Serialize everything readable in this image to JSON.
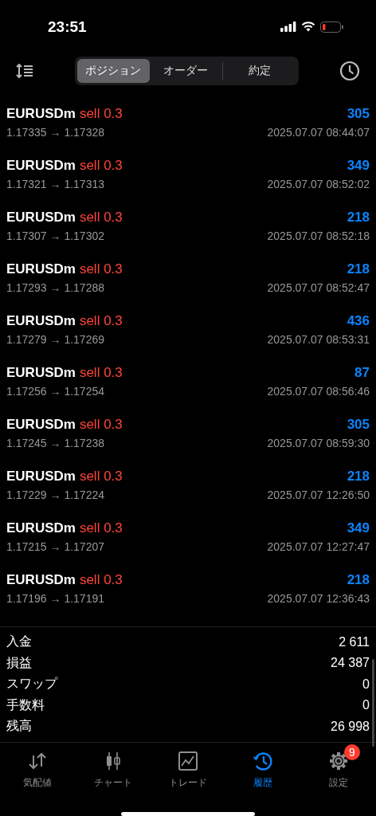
{
  "status_bar": {
    "time": "23:51"
  },
  "segments": [
    {
      "label": "ポジション",
      "selected": true
    },
    {
      "label": "オーダー",
      "selected": false
    },
    {
      "label": "約定",
      "selected": false
    }
  ],
  "deals": [
    {
      "symbol": "EURUSDm",
      "order": "sell 0.3",
      "profit": "305",
      "prices": "1.17335 → 1.17328",
      "time": "2025.07.07 08:44:07"
    },
    {
      "symbol": "EURUSDm",
      "order": "sell 0.3",
      "profit": "349",
      "prices": "1.17321 → 1.17313",
      "time": "2025.07.07 08:52:02"
    },
    {
      "symbol": "EURUSDm",
      "order": "sell 0.3",
      "profit": "218",
      "prices": "1.17307 → 1.17302",
      "time": "2025.07.07 08:52:18"
    },
    {
      "symbol": "EURUSDm",
      "order": "sell 0.3",
      "profit": "218",
      "prices": "1.17293 → 1.17288",
      "time": "2025.07.07 08:52:47"
    },
    {
      "symbol": "EURUSDm",
      "order": "sell 0.3",
      "profit": "436",
      "prices": "1.17279 → 1.17269",
      "time": "2025.07.07 08:53:31"
    },
    {
      "symbol": "EURUSDm",
      "order": "sell 0.3",
      "profit": "87",
      "prices": "1.17256 → 1.17254",
      "time": "2025.07.07 08:56:46"
    },
    {
      "symbol": "EURUSDm",
      "order": "sell 0.3",
      "profit": "305",
      "prices": "1.17245 → 1.17238",
      "time": "2025.07.07 08:59:30"
    },
    {
      "symbol": "EURUSDm",
      "order": "sell 0.3",
      "profit": "218",
      "prices": "1.17229 → 1.17224",
      "time": "2025.07.07 12:26:50"
    },
    {
      "symbol": "EURUSDm",
      "order": "sell 0.3",
      "profit": "349",
      "prices": "1.17215 → 1.17207",
      "time": "2025.07.07 12:27:47"
    },
    {
      "symbol": "EURUSDm",
      "order": "sell 0.3",
      "profit": "218",
      "prices": "1.17196 → 1.17191",
      "time": "2025.07.07 12:36:43"
    }
  ],
  "summary": [
    {
      "label": "入金",
      "value": "2 611"
    },
    {
      "label": "損益",
      "value": "24 387"
    },
    {
      "label": "スワップ",
      "value": "0"
    },
    {
      "label": "手数料",
      "value": "0"
    },
    {
      "label": "残高",
      "value": "26 998"
    }
  ],
  "tab_bar": [
    {
      "label": "気配値",
      "kind": "quotes",
      "selected": false
    },
    {
      "label": "チャート",
      "kind": "chart",
      "selected": false
    },
    {
      "label": "トレード",
      "kind": "trade",
      "selected": false
    },
    {
      "label": "履歴",
      "kind": "history",
      "selected": true
    },
    {
      "label": "設定",
      "kind": "settings",
      "selected": false,
      "badge": "9"
    }
  ]
}
